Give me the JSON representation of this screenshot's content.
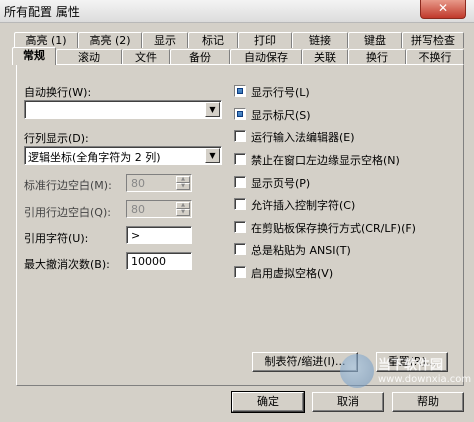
{
  "window": {
    "title": "所有配置 属性",
    "close_label": "✕"
  },
  "tabs_row1": [
    {
      "label": "高亮 (1)"
    },
    {
      "label": "高亮 (2)"
    },
    {
      "label": "显示"
    },
    {
      "label": "标记"
    },
    {
      "label": "打印"
    },
    {
      "label": "链接"
    },
    {
      "label": "键盘"
    },
    {
      "label": "拼写检查"
    }
  ],
  "tabs_row2": [
    {
      "label": "常规",
      "active": true
    },
    {
      "label": "滚动"
    },
    {
      "label": "文件"
    },
    {
      "label": "备份"
    },
    {
      "label": "自动保存"
    },
    {
      "label": "关联"
    },
    {
      "label": "换行"
    },
    {
      "label": "不换行"
    }
  ],
  "left": {
    "auto_wrap_label": "自动换行(W):",
    "auto_wrap_value": "",
    "column_display_label": "行列显示(D):",
    "column_display_value": "逻辑坐标(全角字符为 2 列)",
    "margin_label": "标准行边空白(M):",
    "margin_value": "80",
    "quote_margin_label": "引用行边空白(Q):",
    "quote_margin_value": "80",
    "quote_char_label": "引用字符(U):",
    "quote_char_value": ">",
    "max_undo_label": "最大撤消次数(B):",
    "max_undo_value": "10000"
  },
  "checkboxes": [
    {
      "label": "显示行号(L)",
      "checked": true
    },
    {
      "label": "显示标尺(S)",
      "checked": true
    },
    {
      "label": "运行输入法编辑器(E)",
      "checked": false
    },
    {
      "label": "禁止在窗口左边缘显示空格(N)",
      "checked": false
    },
    {
      "label": "显示页号(P)",
      "checked": false
    },
    {
      "label": "允许插入控制字符(C)",
      "checked": false
    },
    {
      "label": "在剪贴板保存换行方式(CR/LF)(F)",
      "checked": false
    },
    {
      "label": "总是粘贴为 ANSI(T)",
      "checked": false
    },
    {
      "label": "启用虚拟空格(V)",
      "checked": false
    }
  ],
  "buttons": {
    "tab_indent": "制表符/缩进(I)...",
    "reset": "重置(R)...",
    "ok": "确定",
    "cancel": "取消",
    "help": "帮助"
  },
  "watermark": {
    "text": "当下软件园",
    "url": "www.downxia.com"
  }
}
